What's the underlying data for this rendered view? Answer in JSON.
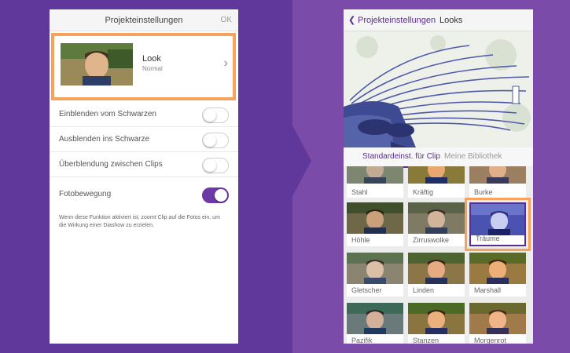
{
  "left_panel": {
    "title": "Projekteinstellungen",
    "ok_label": "OK",
    "look_row": {
      "label": "Look",
      "value": "Normal"
    },
    "settings": [
      {
        "label": "Einblenden vom Schwarzen",
        "enabled": false
      },
      {
        "label": "Ausblenden ins Schwarze",
        "enabled": false
      },
      {
        "label": "Überblendung zwischen Clips",
        "enabled": false
      },
      {
        "label": "Fotobewegung",
        "enabled": true
      }
    ],
    "foto_description": "Wenn diese Funktion aktiviert ist, zoomt Clip auf die Fotos ein, um die Wirkung einer Diashow zu erzielen."
  },
  "right_panel": {
    "back_label": "Projekteinstellungen",
    "title": "Looks",
    "tabs": [
      "Standardeinst. für Clip",
      "Meine Bibliothek"
    ],
    "active_tab": 0,
    "looks": [
      "Stahl",
      "Kräftig",
      "Burke",
      "Höhle",
      "Zirruswolke",
      "Träume",
      "Gletscher",
      "Linden",
      "Marshall",
      "Pazifik",
      "Stanzen",
      "Morgenrot"
    ],
    "selected_look": "Träume"
  },
  "colors": {
    "accent": "#5b2d8e",
    "highlight": "#f5a25d",
    "background_left": "#60379a",
    "background_right": "#7a4ba8"
  },
  "icons": {
    "chevron": "chevron-right-icon",
    "back": "chevron-left-icon"
  }
}
